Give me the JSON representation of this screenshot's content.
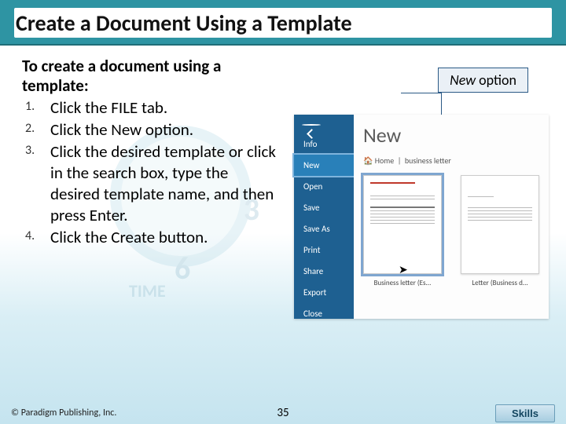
{
  "title": "Create a Document Using a Template",
  "intro": "To create a document using a template:",
  "steps": [
    "Click the FILE tab.",
    "Click the New option.",
    "Click the desired template or click in the search box, type the desired template name, and then press Enter.",
    "Click the Create button."
  ],
  "callout": "New option",
  "file_menu": {
    "items": [
      "Info",
      "New",
      "Open",
      "Save",
      "Save As",
      "Print",
      "Share",
      "Export",
      "Close"
    ],
    "highlighted": "New"
  },
  "new_panel": {
    "title": "New",
    "nav_home": "Home",
    "nav_search": "business letter",
    "templates": [
      {
        "caption": "Business letter (Es...",
        "selected": true
      },
      {
        "caption": "Letter (Business d...",
        "selected": false
      }
    ]
  },
  "footer": {
    "copyright": "© Paradigm Publishing, Inc.",
    "page": "35",
    "skills": "Skills"
  },
  "bg": {
    "num3": "3",
    "num6": "6",
    "label": "TIME"
  }
}
